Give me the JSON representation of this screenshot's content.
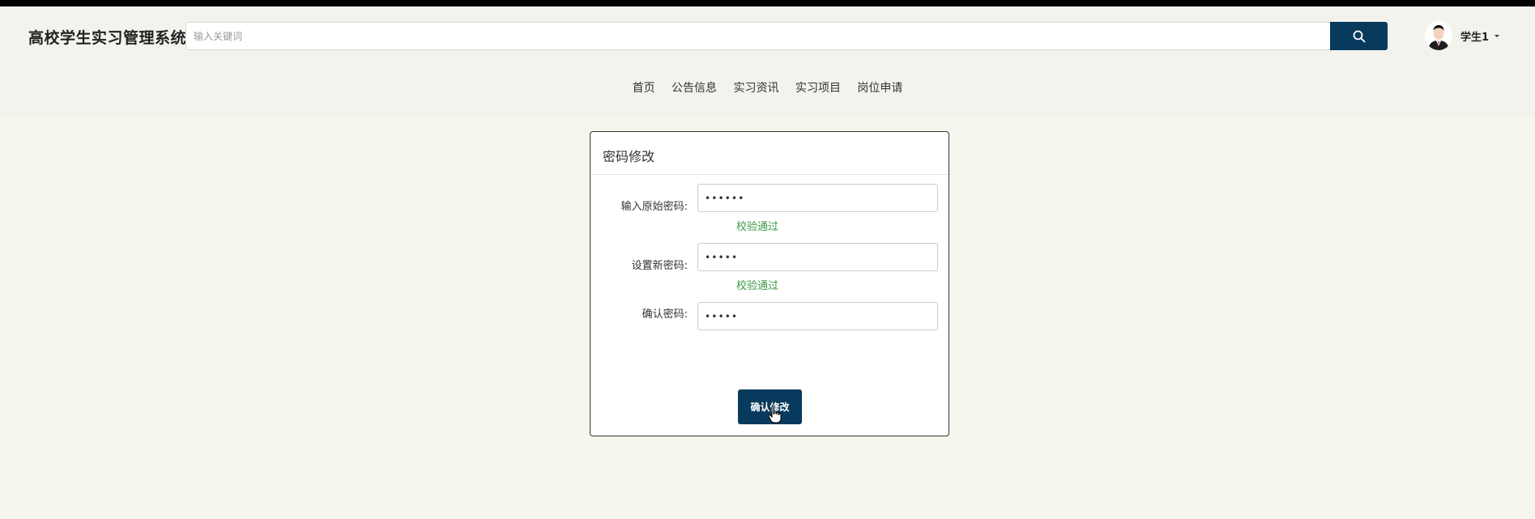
{
  "header": {
    "brand": "高校学生实习管理系统",
    "search": {
      "placeholder": "输入关键词",
      "value": ""
    },
    "user": {
      "name": "学生1"
    }
  },
  "nav": {
    "items": [
      {
        "label": "首页"
      },
      {
        "label": "公告信息"
      },
      {
        "label": "实习资讯"
      },
      {
        "label": "实习项目"
      },
      {
        "label": "岗位申请"
      }
    ]
  },
  "form": {
    "title": "密码修改",
    "fields": [
      {
        "label": "输入原始密码:",
        "value": "••••••",
        "status": "校验通过"
      },
      {
        "label": "设置新密码:",
        "value": "•••••",
        "status": "校验通过"
      },
      {
        "label": "确认密码:",
        "value": "•••••",
        "status": ""
      }
    ],
    "submit_label": "确认修改"
  },
  "colors": {
    "primary": "#073a5c",
    "success": "#3c9a46",
    "background": "#f6f6ee",
    "header_bg": "#f3f2ed"
  },
  "icons": {
    "search": "search-icon",
    "avatar": "user-avatar",
    "caret": "caret-down-icon",
    "cursor": "hand-pointer-icon"
  }
}
